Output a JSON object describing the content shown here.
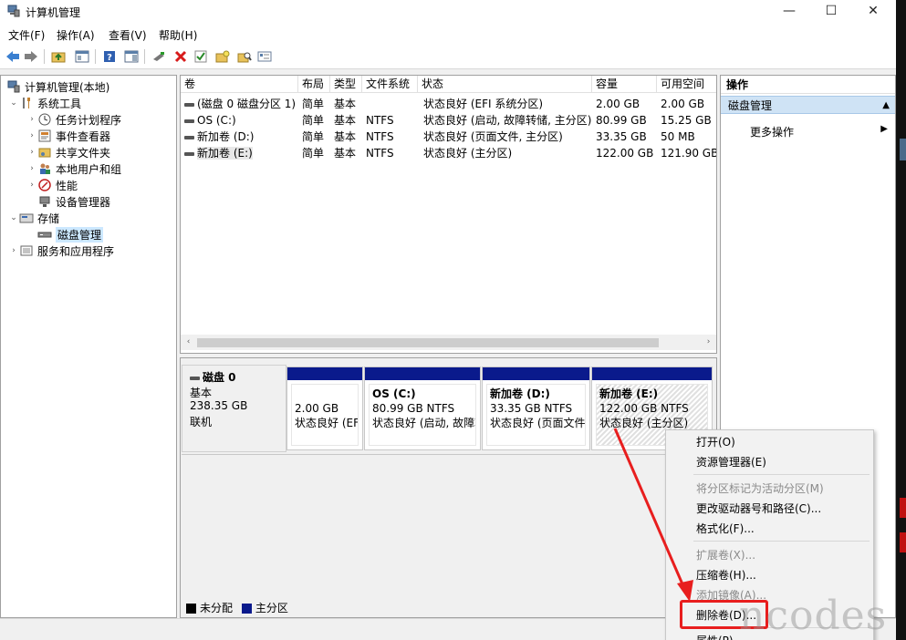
{
  "window": {
    "title": "计算机管理",
    "min": "—",
    "max": "☐",
    "close": "✕"
  },
  "menu": [
    "文件(F)",
    "操作(A)",
    "查看(V)",
    "帮助(H)"
  ],
  "tree": {
    "root": "计算机管理(本地)",
    "system_tools": "系统工具",
    "task_scheduler": "任务计划程序",
    "event_viewer": "事件查看器",
    "shared_folders": "共享文件夹",
    "local_users": "本地用户和组",
    "performance": "性能",
    "device_manager": "设备管理器",
    "storage": "存储",
    "disk_management": "磁盘管理",
    "services": "服务和应用程序"
  },
  "volumes": {
    "headers": [
      "卷",
      "布局",
      "类型",
      "文件系统",
      "状态",
      "容量",
      "可用空间"
    ],
    "rows": [
      [
        "(磁盘 0 磁盘分区 1)",
        "简单",
        "基本",
        "",
        "状态良好 (EFI 系统分区)",
        "2.00 GB",
        "2.00 GB"
      ],
      [
        "OS (C:)",
        "简单",
        "基本",
        "NTFS",
        "状态良好 (启动, 故障转储, 主分区)",
        "80.99 GB",
        "15.25 GB"
      ],
      [
        "新加卷 (D:)",
        "简单",
        "基本",
        "NTFS",
        "状态良好 (页面文件, 主分区)",
        "33.35 GB",
        "50 MB"
      ],
      [
        "新加卷 (E:)",
        "简单",
        "基本",
        "NTFS",
        "状态良好 (主分区)",
        "122.00 GB",
        "121.90 GB"
      ]
    ]
  },
  "disk": {
    "name": "磁盘 0",
    "type": "基本",
    "size": "238.35 GB",
    "status": "联机",
    "partitions": [
      {
        "name": "",
        "line1": "2.00 GB",
        "line2": "状态良好 (EFI"
      },
      {
        "name": "OS  (C:)",
        "line1": "80.99 GB NTFS",
        "line2": "状态良好 (启动, 故障转"
      },
      {
        "name": "新加卷  (D:)",
        "line1": "33.35 GB NTFS",
        "line2": "状态良好 (页面文件"
      },
      {
        "name": "新加卷  (E:)",
        "line1": "122.00 GB NTFS",
        "line2": "状态良好 (主分区)"
      }
    ]
  },
  "legend": {
    "unallocated": "未分配",
    "primary": "主分区"
  },
  "actions": {
    "header": "操作",
    "selected": "磁盘管理",
    "more": "更多操作"
  },
  "context_menu": {
    "open": "打开(O)",
    "explore": "资源管理器(E)",
    "mark_active": "将分区标记为活动分区(M)",
    "change_letter": "更改驱动器号和路径(C)...",
    "format": "格式化(F)...",
    "extend": "扩展卷(X)...",
    "shrink": "压缩卷(H)...",
    "add_mirror": "添加镜像(A)...",
    "delete": "删除卷(D)...",
    "properties": "属性(P)"
  },
  "watermark": "ncodes",
  "colors": {
    "partition_bar": "#0a1a8c",
    "highlight": "#e81e1e",
    "arrow": "#e81e1e"
  }
}
